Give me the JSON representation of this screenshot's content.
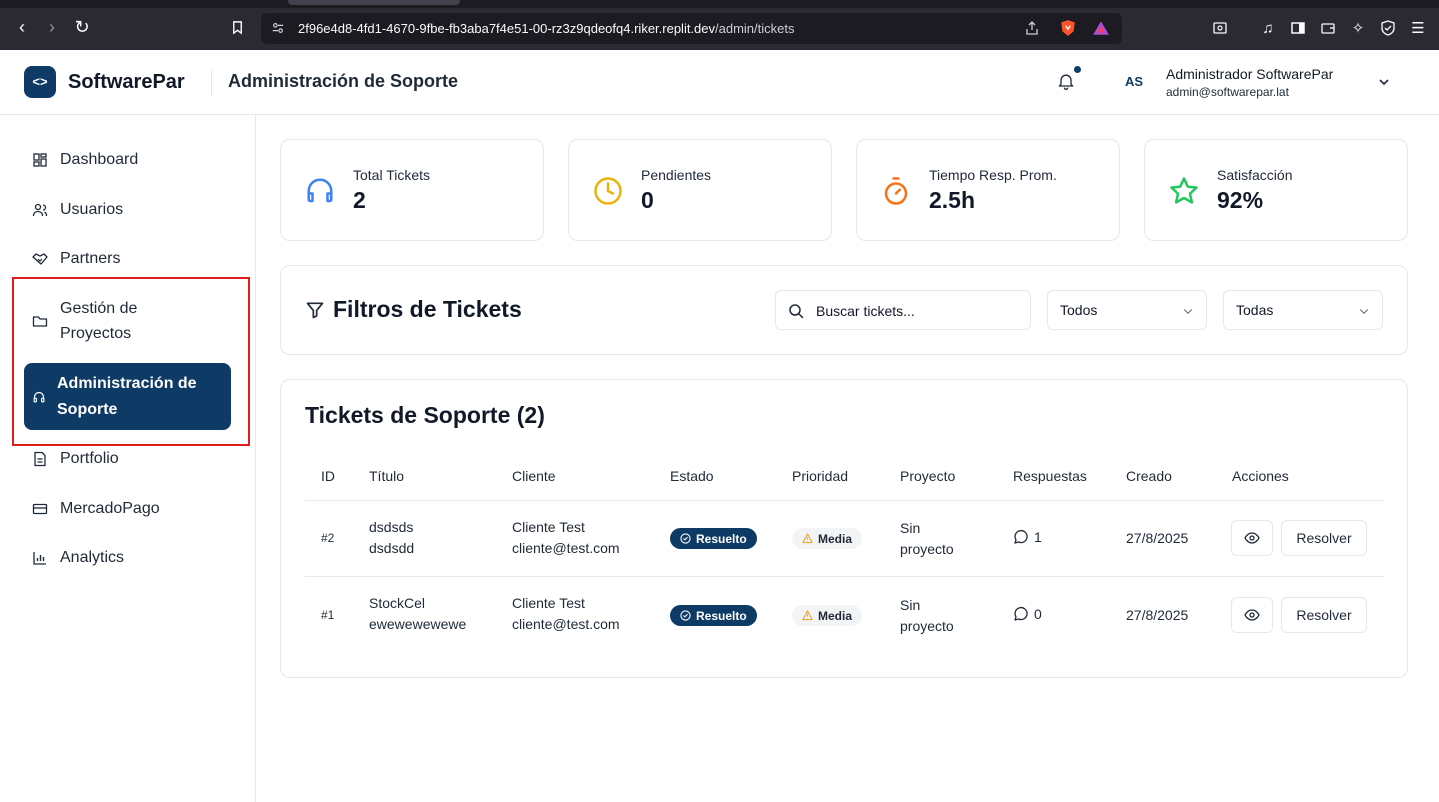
{
  "browser": {
    "url_host": "2f96e4d8-4fd1-4670-9fbe-fb3aba7f4e51-00-rz3z9qdeofq4.riker.replit.dev",
    "url_path": "/admin/tickets"
  },
  "header": {
    "logo_glyph": "<>",
    "brand": "SoftwarePar",
    "title": "Administración de Soporte",
    "avatar_initials": "AS",
    "user_name": "Administrador SoftwarePar",
    "user_email": "admin@softwarepar.lat"
  },
  "sidebar": {
    "items": [
      {
        "label": "Dashboard",
        "icon": "dashboard-icon"
      },
      {
        "label": "Usuarios",
        "icon": "users-icon"
      },
      {
        "label": "Partners",
        "icon": "handshake-icon"
      },
      {
        "label": "Gestión de Proyectos",
        "line1": "Gestión de",
        "line2": "Proyectos",
        "icon": "folder-icon"
      },
      {
        "label": "Administración de Soporte",
        "line1": "Administración de",
        "line2": "Soporte",
        "icon": "headphones-icon",
        "active": true
      },
      {
        "label": "Portfolio",
        "icon": "file-icon"
      },
      {
        "label": "MercadoPago",
        "icon": "credit-card-icon"
      },
      {
        "label": "Analytics",
        "icon": "bar-chart-icon"
      }
    ]
  },
  "stats": [
    {
      "label": "Total Tickets",
      "value": "2",
      "icon": "headphones-icon",
      "color": "#3b82f6"
    },
    {
      "label": "Pendientes",
      "value": "0",
      "icon": "clock-icon",
      "color": "#eab308"
    },
    {
      "label": "Tiempo Resp. Prom.",
      "value": "2.5h",
      "icon": "timer-icon",
      "color": "#f97316"
    },
    {
      "label": "Satisfacción",
      "value": "92%",
      "icon": "star-icon",
      "color": "#22c55e"
    }
  ],
  "filters": {
    "title": "Filtros de Tickets",
    "search_placeholder": "Buscar tickets...",
    "status_select": "Todos",
    "priority_select": "Todas"
  },
  "tickets": {
    "title": "Tickets de Soporte (2)",
    "columns": [
      "ID",
      "Título",
      "Cliente",
      "Estado",
      "Prioridad",
      "Proyecto",
      "Respuestas",
      "Creado",
      "Acciones"
    ],
    "rows": [
      {
        "id": "#2",
        "title_line1": "dsdsds",
        "title_line2": "dsdsdd",
        "client_name": "Cliente Test",
        "client_email": "cliente@test.com",
        "status": "Resuelto",
        "priority": "Media",
        "project_line1": "Sin",
        "project_line2": "proyecto",
        "responses": "1",
        "created": "27/8/2025",
        "action_label": "Resolver"
      },
      {
        "id": "#1",
        "title_line1": "StockCel",
        "title_line2": "ewewewewewe",
        "client_name": "Cliente Test",
        "client_email": "cliente@test.com",
        "status": "Resuelto",
        "priority": "Media",
        "project_line1": "Sin",
        "project_line2": "proyecto",
        "responses": "0",
        "created": "27/8/2025",
        "action_label": "Resolver"
      }
    ]
  },
  "colors": {
    "primary": "#0e3a66",
    "highlight_border": "#e11d1d",
    "warning": "#f59e0b"
  }
}
